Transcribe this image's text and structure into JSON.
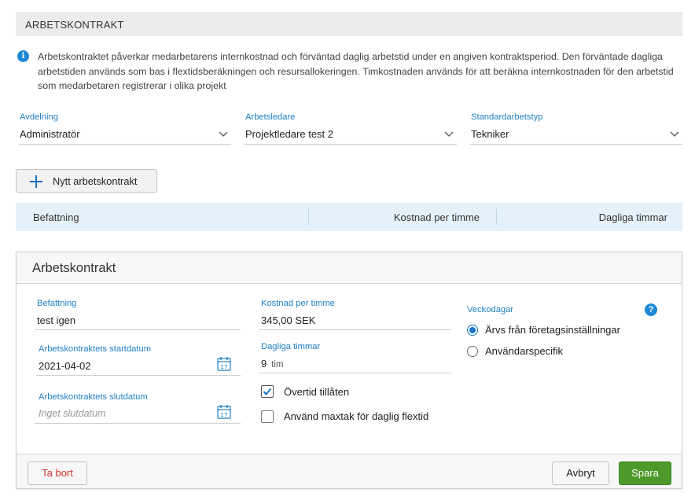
{
  "section": {
    "title": "ARBETSKONTRAKT"
  },
  "info": {
    "icon": "info-icon",
    "text": "Arbetskontraktet påverkar medarbetarens internkostnad och förväntad daglig arbetstid under en angiven kontraktsperiod. Den förväntade dagliga arbetstiden används som bas i flextidsberäkningen och resursallokeringen. Timkostnaden används för att beräkna internkostnaden för den arbetstid som medarbetaren registrerar i olika projekt"
  },
  "dropdowns": {
    "department": {
      "label": "Avdelning",
      "value": "Administratör"
    },
    "manager": {
      "label": "Arbetsledare",
      "value": "Projektledare test 2"
    },
    "work_type": {
      "label": "Standardarbetstyp",
      "value": "Tekniker"
    }
  },
  "new_contract_button": {
    "label": "Nytt arbetskontrakt",
    "icon": "plus-icon"
  },
  "table": {
    "columns": [
      "Befattning",
      "Kostnad per timme",
      "Dagliga timmar"
    ]
  },
  "card": {
    "title": "Arbetskontrakt",
    "position": {
      "label": "Befattning",
      "value": "test igen"
    },
    "start_date": {
      "label": "Arbetskontraktets startdatum",
      "value": "2021-04-02"
    },
    "end_date": {
      "label": "Arbetskontraktets slutdatum",
      "placeholder": "Inget slutdatum"
    },
    "cost_per_hour": {
      "label": "Kostnad per timme",
      "value": "345,00 SEK"
    },
    "daily_hours": {
      "label": "Dagliga timmar",
      "value": "9",
      "unit": "tim"
    },
    "overtime": {
      "label": "Övertid tillåten",
      "checked": true
    },
    "max_flex": {
      "label": "Använd maxtak för daglig flextid",
      "checked": false
    },
    "weekdays": {
      "label": "Veckodagar",
      "options": [
        {
          "label": "Ärvs från företagsinställningar",
          "selected": true
        },
        {
          "label": "Användarspecifik",
          "selected": false
        }
      ]
    },
    "help_symbol": "?",
    "buttons": {
      "delete": "Ta bort",
      "cancel": "Avbryt",
      "save": "Spara"
    }
  },
  "colors": {
    "accent": "#1e7fc4",
    "save": "#4d9a2a",
    "delete_text": "#d0322f",
    "table_header": "#e5f1fa"
  }
}
